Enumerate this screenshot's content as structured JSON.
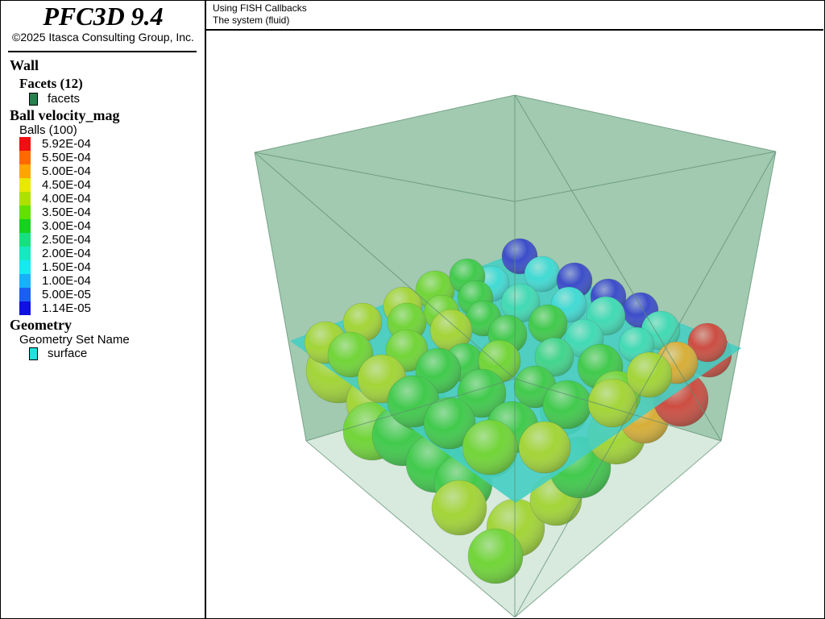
{
  "app": {
    "title": "PFC3D 9.4",
    "copyright": "©2025 Itasca Consulting Group, Inc."
  },
  "header": {
    "line1": "Using FISH Callbacks",
    "line2": "The system (fluid)"
  },
  "legend": {
    "wall": {
      "heading": "Wall",
      "sub_heading": "Facets (12)",
      "item_label": "facets",
      "item_color": "#2e7d4f"
    },
    "velocity": {
      "heading": "Ball velocity_mag",
      "sub_heading": "Balls (100)",
      "labels": [
        "5.92E-04",
        "5.50E-04",
        "5.00E-04",
        "4.50E-04",
        "4.00E-04",
        "3.50E-04",
        "3.00E-04",
        "2.50E-04",
        "2.00E-04",
        "1.50E-04",
        "1.00E-04",
        "5.00E-05",
        "1.14E-05"
      ],
      "colors": [
        "#ee1010",
        "#ff6a00",
        "#ffa500",
        "#e8e800",
        "#aee000",
        "#62e000",
        "#18d020",
        "#18e080",
        "#18e8c0",
        "#18e8f0",
        "#1ab0f8",
        "#1a60f0",
        "#1010e0"
      ]
    },
    "geometry": {
      "heading": "Geometry",
      "sub_heading": "Geometry Set Name",
      "item_label": "surface",
      "item_color": "#20e0e0"
    }
  },
  "scene": {
    "box_fill": "#8fbfa0",
    "plane_color": "#1fd6d6"
  }
}
